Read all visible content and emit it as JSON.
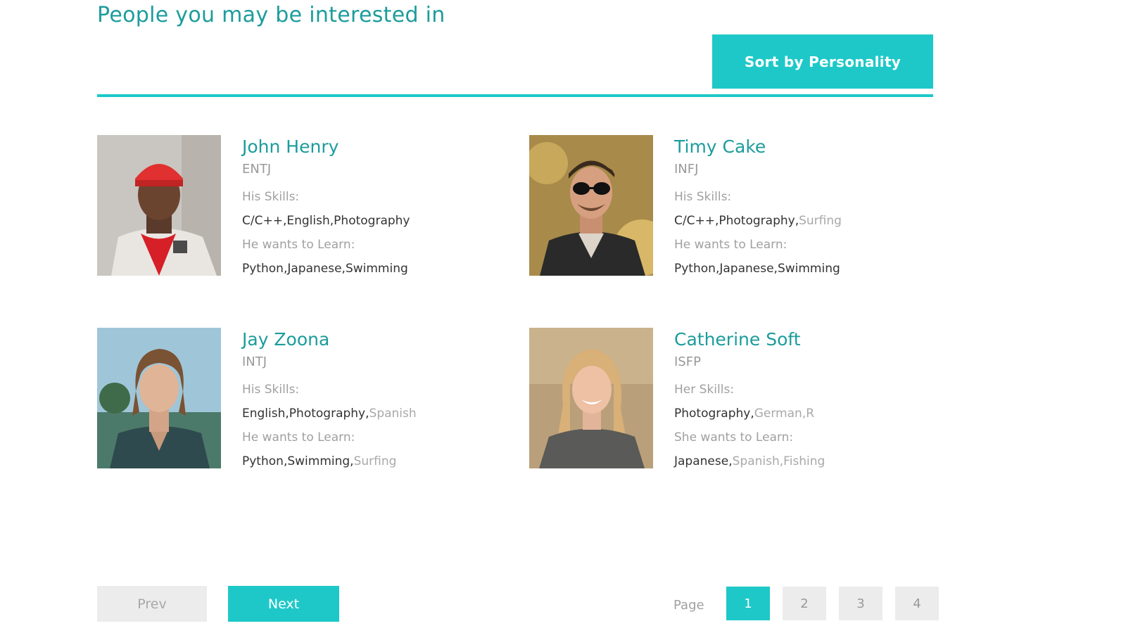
{
  "header": {
    "title": "People you may be interested in",
    "sort_label": "Sort by Personality"
  },
  "colors": {
    "accent": "#1ec8c8",
    "title": "#1d9c9c"
  },
  "people": [
    {
      "name": "John Henry",
      "type": "ENTJ",
      "skills_label": "His Skills:",
      "skills": [
        {
          "text": "C/C++",
          "sep": ","
        },
        {
          "text": "English",
          "sep": ","
        },
        {
          "text": "Photography",
          "sep": ""
        }
      ],
      "learn_label": "He wants to Learn:",
      "learn": [
        {
          "text": "Python",
          "sep": ","
        },
        {
          "text": "Japanese",
          "sep": ","
        },
        {
          "text": "Swimming",
          "sep": ""
        }
      ]
    },
    {
      "name": "Timy Cake",
      "type": "INFJ",
      "skills_label": "His Skills:",
      "skills": [
        {
          "text": "C/C++",
          "sep": ","
        },
        {
          "text": "Photography",
          "sep": ","
        },
        {
          "text": "Surfing",
          "sep": ""
        }
      ],
      "learn_label": "He wants to Learn:",
      "learn": [
        {
          "text": "Python",
          "sep": ","
        },
        {
          "text": "Japanese",
          "sep": ","
        },
        {
          "text": "Swimming",
          "sep": ""
        }
      ]
    },
    {
      "name": "Jay Zoona",
      "type": "INTJ",
      "skills_label": "His Skills:",
      "skills": [
        {
          "text": "English",
          "sep": ","
        },
        {
          "text": "Photography",
          "sep": ","
        },
        {
          "text": "Spanish",
          "sep": ""
        }
      ],
      "learn_label": "He wants to Learn:",
      "learn": [
        {
          "text": "Python",
          "sep": ","
        },
        {
          "text": "Swimming",
          "sep": ","
        },
        {
          "text": "Surfing",
          "sep": ""
        }
      ]
    },
    {
      "name": "Catherine Soft",
      "type": "ISFP",
      "skills_label": "Her Skills:",
      "skills": [
        {
          "text": "Photography",
          "sep": ","
        },
        {
          "text": "German",
          "sep": ","
        },
        {
          "text": "R",
          "sep": ""
        }
      ],
      "learn_label": "She wants to Learn:",
      "learn": [
        {
          "text": "Japanese",
          "sep": ","
        },
        {
          "text": "Spanish",
          "sep": ","
        },
        {
          "text": "Fishing",
          "sep": ""
        }
      ]
    }
  ],
  "pagination": {
    "prev_label": "Prev",
    "next_label": "Next",
    "page_label": "Page",
    "pages": [
      "1",
      "2",
      "3",
      "4"
    ],
    "current_page": "1"
  }
}
